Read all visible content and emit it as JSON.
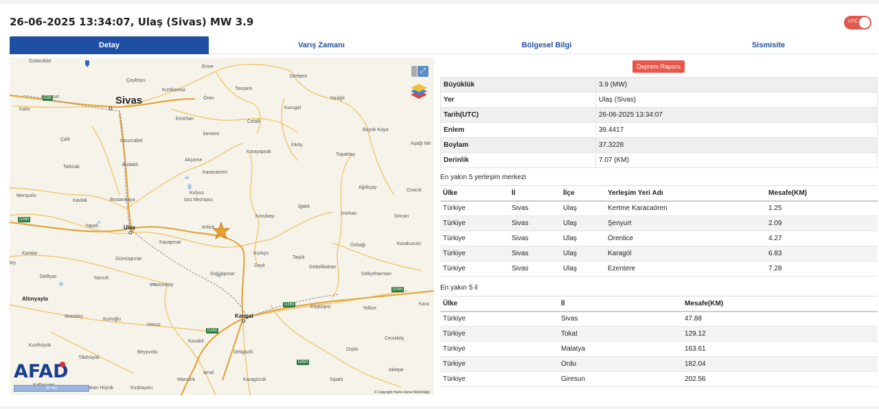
{
  "header": {
    "title": "26-06-2025 13:34:07, Ulaş (Sivas) MW 3.9",
    "utc_toggle_label": "UTC"
  },
  "tabs": [
    {
      "label": "Detay",
      "active": true
    },
    {
      "label": "Varış Zamanı",
      "active": false
    },
    {
      "label": "Bölgesel Bilgi",
      "active": false
    },
    {
      "label": "Sismisite",
      "active": false
    }
  ],
  "map": {
    "labels": {
      "sivas": "Sivas",
      "ulas": "Ulaş",
      "kangal": "Kangal",
      "altinyayla": "Altınyayla",
      "emre": "Emre",
      "cayboyu": "Çayboyu",
      "derbent": "Derbent",
      "kizilkavraz": "Kızılkavraz",
      "oren": "Ören",
      "tavsanli": "Tavşanlı",
      "yaragil": "Yarağıl",
      "kurugol": "Kurugöl",
      "kalin": "Kalın",
      "kumyurt": "Kumyurt",
      "emirhan": "Emirhan",
      "celalli": "Celalli",
      "buyukkaya": "Büyük Kaya",
      "calli": "Çallı",
      "kement": "kement",
      "yassicabel": "Yassıcabel",
      "inkoy": "İnköy",
      "topaktas": "Topaktaş",
      "asagime": "Aşağı Me",
      "karayaprak": "Karayaprak",
      "akcame": "Akçame",
      "tatlicak": "Tatlıcak",
      "budakli": "Budaklı",
      "karacaoren": "Karacaören",
      "agilkcay": "Ağılkçay",
      "ovacik": "Ovacık",
      "mensurlu": "Menşurlu",
      "kavlak": "Kavlak",
      "bostankaya": "Bostankaya",
      "kulyus": "Kulyus",
      "ozu": "özü Mezraası",
      "igdeli": "İğdeli",
      "imirhan": "İmirhan",
      "korubasi": "Korubaşı",
      "sincan": "Sincan",
      "yapali": "Yapalı",
      "enlice": "enlice",
      "kayapinar": "Kayapınar",
      "ozbagi": "Özbağı",
      "karakuzulu": "Karakuzulu",
      "karalar": "Karalar",
      "gumuspinar": "Gümüşpınar",
      "kurkcu": "Kürkçü",
      "tasli": "Taşlık",
      "dayli": "Daylı",
      "gebelikatran": "Gebelikatran",
      "delilyas": "Delilyas",
      "yazicik": "Yazıcık",
      "sogukpinar": "Soğukpınar",
      "gokceharman": "Gökçeharman",
      "imaminkoy": "İmamınköy",
      "mutubey": "Mutubey",
      "kurtoglu": "Kurtoğlu",
      "havuz": "Havuz",
      "yellice": "Yellice",
      "koskopru": "Köşköprü",
      "kizilhuyuk": "Kızılhüyük",
      "kocakli": "Kocaklı",
      "cevizkoy": "Cevizköy",
      "tilkihuyuk": "Tilkihüyük",
      "beyyurdu": "Beyyurdu",
      "deligazili": "Deligazili",
      "dislik": "Dışlık",
      "mancilik": "Mancılık",
      "amal": "amal",
      "karagucuk": "Karagücük",
      "sipahi": "Sipahi",
      "aktepe": "Aktepe",
      "kaftanyeri": "Kaftanyeri",
      "yakanhuyuk": "Yakan Hüyük",
      "kuskayasi": "Kuşkayası",
      "ley": "ley",
      "kara": "Kara",
      "ozbecikler": "Ozbecikler"
    },
    "roads": {
      "e88": "E88",
      "d260": "D260",
      "d850": "D850"
    },
    "brand": "AFAD",
    "scale": "20 km",
    "copyright": "© Copyright Harita Genel Müdürlüğü"
  },
  "report_button": "Deprem Raporu",
  "info": [
    {
      "key": "Büyüklük",
      "value": "3.9 (MW)"
    },
    {
      "key": "Yer",
      "value": "Ulaş (Sivas)"
    },
    {
      "key": "Tarih(UTC)",
      "value": "26-06-2025 13:34:07"
    },
    {
      "key": "Enlem",
      "value": "39.4417"
    },
    {
      "key": "Boylam",
      "value": "37.3228"
    },
    {
      "key": "Derinlik",
      "value": "7.07 (KM)"
    }
  ],
  "settlements": {
    "title": "En yakın 5 yerleşim merkezi",
    "headers": [
      "Ülke",
      "İl",
      "İlçe",
      "Yerleşim Yeri Adı",
      "Mesafe(KM)"
    ],
    "rows": [
      [
        "Türkiye",
        "Sivas",
        "Ulaş",
        "Kertme Karacaören",
        "1.25"
      ],
      [
        "Türkiye",
        "Sivas",
        "Ulaş",
        "Şenyurt",
        "2.09"
      ],
      [
        "Türkiye",
        "Sivas",
        "Ulaş",
        "Örenlice",
        "4.27"
      ],
      [
        "Türkiye",
        "Sivas",
        "Ulaş",
        "Karagöl",
        "6.83"
      ],
      [
        "Türkiye",
        "Sivas",
        "Ulaş",
        "Ezentere",
        "7.28"
      ]
    ]
  },
  "provinces": {
    "title": "En yakın 5 il",
    "headers": [
      "Ülke",
      "İl",
      "Mesafe(KM)"
    ],
    "rows": [
      [
        "Türkiye",
        "Sivas",
        "47.88"
      ],
      [
        "Türkiye",
        "Tokat",
        "129.12"
      ],
      [
        "Türkiye",
        "Malatya",
        "163.61"
      ],
      [
        "Türkiye",
        "Ordu",
        "182.04"
      ],
      [
        "Türkiye",
        "Giresun",
        "202.56"
      ]
    ]
  },
  "colors": {
    "accent": "#1f4fa3",
    "report": "#e9574a",
    "toggle": "#e05a4f",
    "road": "#f2c66d",
    "road_major": "#e2a63e",
    "water": "#a9c8ee",
    "epicenter": "#e8a030"
  }
}
